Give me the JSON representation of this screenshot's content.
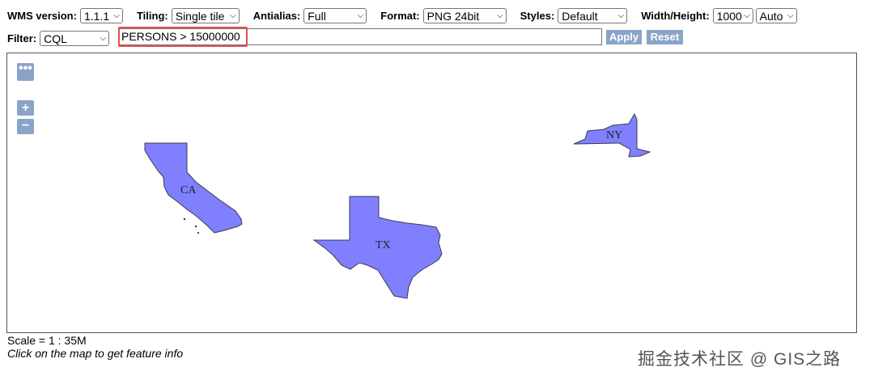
{
  "toolbar": {
    "wms_version": {
      "label": "WMS version:",
      "value": "1.1.1"
    },
    "tiling": {
      "label": "Tiling:",
      "value": "Single tile"
    },
    "antialias": {
      "label": "Antialias:",
      "value": "Full"
    },
    "format": {
      "label": "Format:",
      "value": "PNG 24bit"
    },
    "styles": {
      "label": "Styles:",
      "value": "Default"
    },
    "width_height": {
      "label": "Width/Height:",
      "width": "1000",
      "height": "Auto"
    }
  },
  "filter": {
    "label": "Filter:",
    "type": "CQL",
    "expression": "PERSONS > 15000000",
    "apply_label": "Apply",
    "reset_label": "Reset"
  },
  "map": {
    "controls": {
      "more": "•••",
      "zoom_in": "+",
      "zoom_out": "−"
    },
    "states": [
      {
        "abbr": "CA",
        "fill": "#8080ff"
      },
      {
        "abbr": "TX",
        "fill": "#8080ff"
      },
      {
        "abbr": "NY",
        "fill": "#8080ff"
      }
    ]
  },
  "status": {
    "scale": "Scale = 1 : 35M",
    "hint": "Click on the map to get feature info"
  },
  "watermark": "掘金技术社区 @ GIS之路",
  "colors": {
    "button": "#8aa4c8",
    "highlight": "#e25050",
    "feature": "#8080ff"
  }
}
